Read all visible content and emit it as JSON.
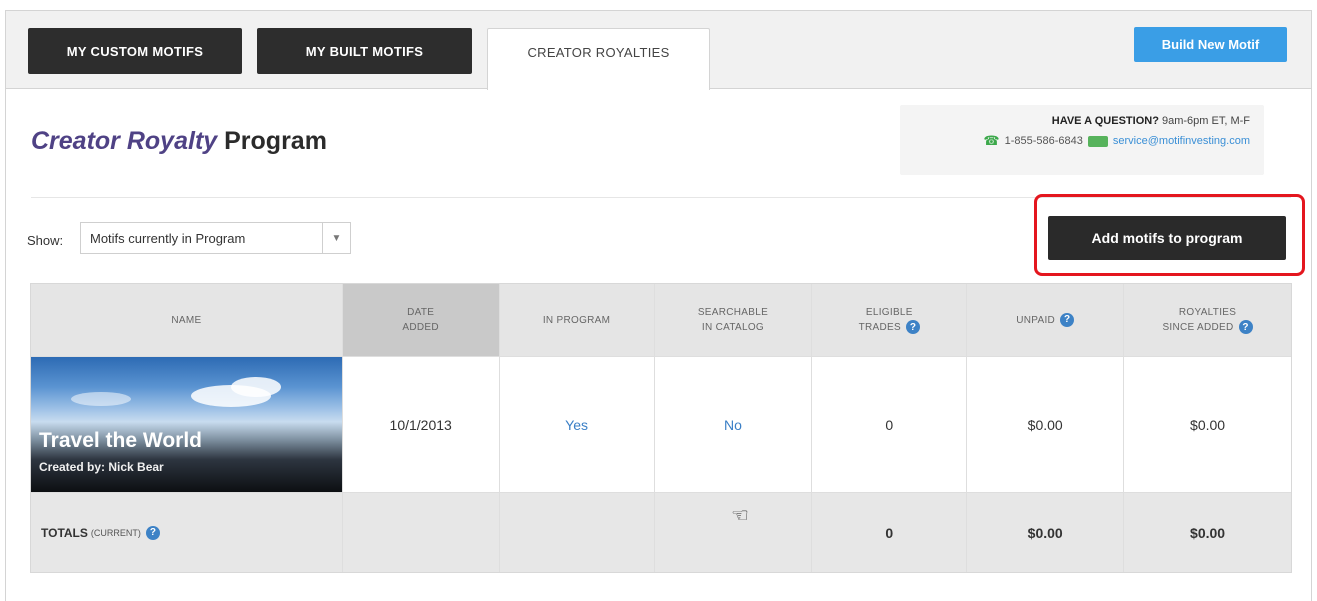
{
  "tabs": {
    "custom": "MY CUSTOM MOTIFS",
    "built": "MY BUILT MOTIFS",
    "royalties": "CREATOR ROYALTIES"
  },
  "build_button": "Build New Motif",
  "heading": {
    "em": "Creator Royalty",
    "plain": "Program"
  },
  "question": {
    "title": "HAVE A QUESTION?",
    "hours": "9am-6pm ET, M-F",
    "phone": "1-855-586-6843",
    "email": "service@motifinvesting.com",
    "phone_icon": "phone-icon",
    "mail_icon": "mail-icon"
  },
  "show": {
    "label": "Show:",
    "selected": "Motifs currently in Program"
  },
  "add_button": "Add motifs to program",
  "table": {
    "headers": {
      "name": "NAME",
      "date_line1": "DATE",
      "date_line2": "ADDED",
      "in_program": "IN PROGRAM",
      "search_line1": "SEARCHABLE",
      "search_line2": "IN CATALOG",
      "elig_line1": "ELIGIBLE",
      "elig_line2": "TRADES",
      "unpaid": "UNPAID",
      "roy_line1": "ROYALTIES",
      "roy_line2": "SINCE ADDED"
    },
    "row": {
      "title": "Travel the World",
      "creator": "Created by: Nick Bear",
      "date_added": "10/1/2013",
      "in_program": "Yes",
      "searchable": "No",
      "eligible_trades": "0",
      "unpaid": "$0.00",
      "royalties": "$0.00"
    },
    "totals": {
      "label": "TOTALS",
      "sub": "(CURRENT)",
      "eligible_trades": "0",
      "unpaid": "$0.00",
      "royalties": "$0.00"
    }
  },
  "colors": {
    "brand_purple": "#4f4285",
    "build_blue": "#3a9ee6",
    "highlight_red": "#e4161e",
    "help_blue": "#3d82c6"
  }
}
